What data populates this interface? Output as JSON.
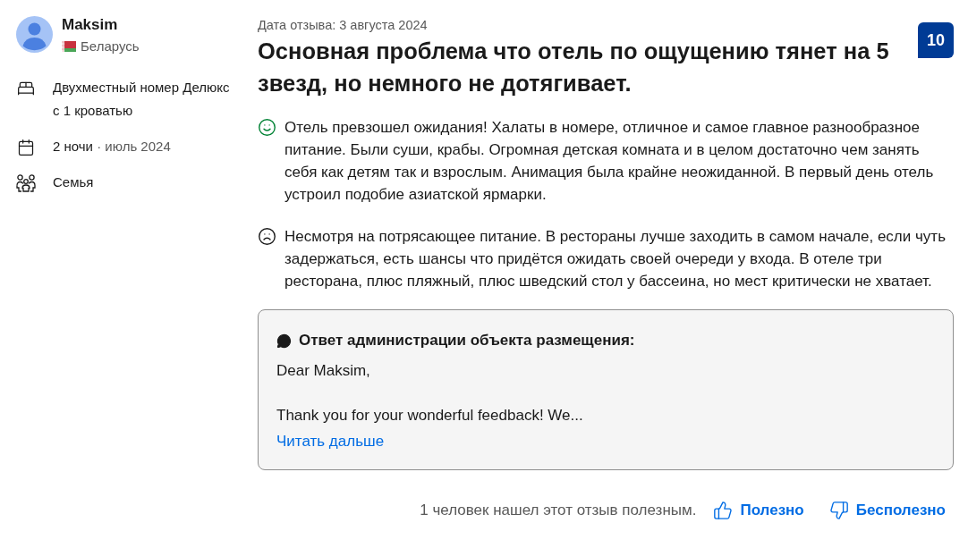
{
  "reviewer": {
    "name": "Maksim",
    "country": "Беларусь"
  },
  "stay_details": [
    {
      "kind": "room",
      "text": "Двухместный номер Делюкс с 1 кроватью"
    },
    {
      "kind": "dates",
      "text": "2 ночи",
      "subtext": "· июль 2024"
    },
    {
      "kind": "group",
      "text": "Семья"
    }
  ],
  "review": {
    "date": "Дата отзыва: 3 августа 2024",
    "title": "Основная проблема что отель по ощущению тянет на 5 звезд, но немного не дотягивает.",
    "score": "10",
    "comments": [
      {
        "kind": "liked",
        "text": "Отель превзошел ожидания! Халаты в номере, отличное и самое главное разнообразное питание. Были суши, крабы. Огромная детская комната и в целом достаточно чем занять себя как детям так и взрослым. Анимация была крайне неожиданной. В первый день отель устроил подобие азиатской ярмарки."
      },
      {
        "kind": "disliked",
        "text": "Несмотря на потрясающее питание. В рестораны лучше заходить в самом начале, если чуть задержаться, есть шансы что придётся ожидать своей очереди у входа. В отеле три ресторана, плюс пляжный, плюс шведский стол у бассеина, но мест критически не хватает."
      }
    ]
  },
  "property_response": {
    "heading": "Ответ администрации объекта размещения:",
    "paragraphs": [
      "Dear Maksim,",
      "Thank you for your wonderful feedback! We..."
    ],
    "read_more": "Читать дальше"
  },
  "helpfulness": {
    "count_text": "1 человек нашел этот отзыв полезным.",
    "buttons": [
      {
        "kind": "helpful",
        "label": "Полезно"
      },
      {
        "kind": "unhelpful",
        "label": "Бесполезно"
      }
    ]
  }
}
